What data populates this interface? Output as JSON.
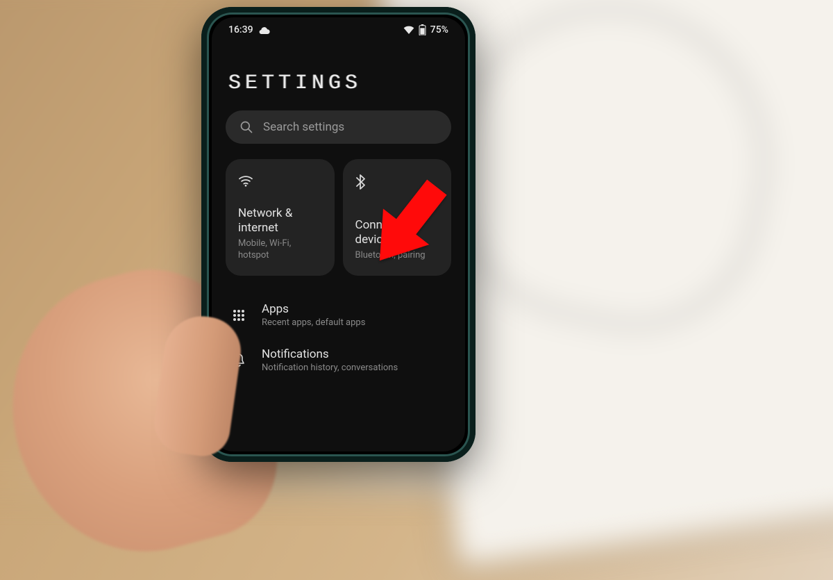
{
  "status": {
    "time": "16:39",
    "battery_percent": "75%"
  },
  "header": {
    "title": "SETTINGS"
  },
  "search": {
    "placeholder": "Search settings"
  },
  "tiles": [
    {
      "icon": "wifi-icon",
      "title": "Network & internet",
      "subtitle": "Mobile, Wi-Fi, hotspot"
    },
    {
      "icon": "bluetooth-icon",
      "title": "Connected devices",
      "subtitle": "Bluetooth, pairing"
    }
  ],
  "list": [
    {
      "icon": "apps-icon",
      "title": "Apps",
      "subtitle": "Recent apps, default apps"
    },
    {
      "icon": "bell-icon",
      "title": "Notifications",
      "subtitle": "Notification history, conversations"
    }
  ],
  "annotation": {
    "arrow_color": "#ff0000"
  }
}
